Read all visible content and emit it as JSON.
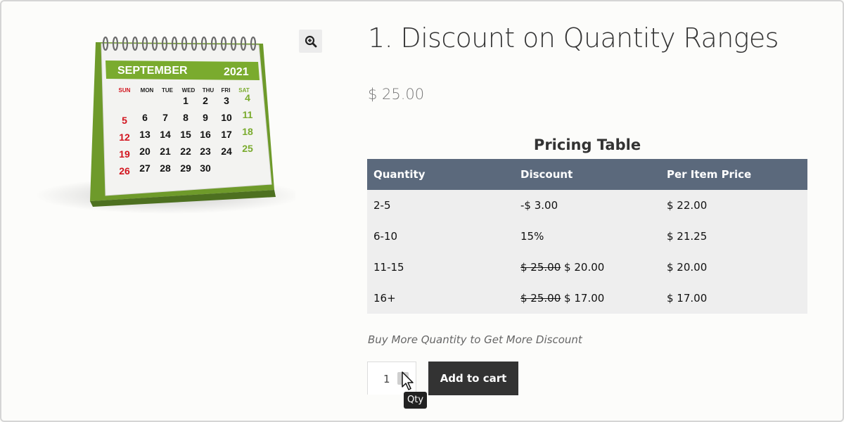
{
  "product": {
    "title": "1. Discount on Quantity Ranges",
    "price": "$ 25.00",
    "zoom_icon": "magnifier-plus-icon"
  },
  "calendar_image": {
    "month": "SEPTEMBER",
    "year": "2021",
    "weekdays": [
      "SUN",
      "MON",
      "TUE",
      "WED",
      "THU",
      "FRI",
      "SAT"
    ],
    "weeks": [
      [
        "",
        "",
        "",
        "1",
        "2",
        "3",
        "4"
      ],
      [
        "5",
        "6",
        "7",
        "8",
        "9",
        "10",
        "11"
      ],
      [
        "12",
        "13",
        "14",
        "15",
        "16",
        "17",
        "18"
      ],
      [
        "19",
        "20",
        "21",
        "22",
        "23",
        "24",
        "25"
      ],
      [
        "26",
        "27",
        "28",
        "29",
        "30",
        "",
        ""
      ]
    ],
    "colors": {
      "accent": "#7aab2e",
      "sunday": "#d2141e"
    }
  },
  "pricing_table": {
    "caption": "Pricing Table",
    "headers": [
      "Quantity",
      "Discount",
      "Per Item Price"
    ],
    "rows": [
      {
        "quantity": "2-5",
        "discount_old": "",
        "discount": "-$ 3.00",
        "per_item": "$ 22.00"
      },
      {
        "quantity": "6-10",
        "discount_old": "",
        "discount": "15%",
        "per_item": "$ 21.25"
      },
      {
        "quantity": "11-15",
        "discount_old": "$ 25.00",
        "discount": "$ 20.00",
        "per_item": "$ 20.00"
      },
      {
        "quantity": "16+",
        "discount_old": "$ 25.00",
        "discount": "$ 17.00",
        "per_item": "$ 17.00"
      }
    ],
    "header_color": "#5b697c"
  },
  "promo_text": "Buy More Quantity to Get More Discount",
  "cart": {
    "quantity_value": "1",
    "add_to_cart_label": "Add to cart",
    "tooltip": "Qty",
    "button_color": "#333333"
  }
}
